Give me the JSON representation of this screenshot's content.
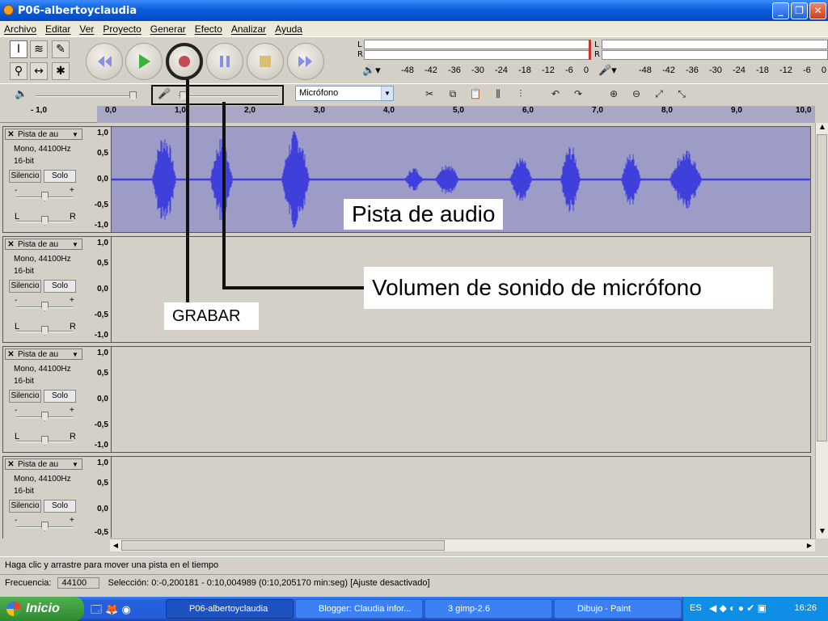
{
  "window": {
    "title": "P06-albertoyclaudia"
  },
  "menu": [
    "Archivo",
    "Editar",
    "Ver",
    "Proyecto",
    "Generar",
    "Efecto",
    "Analizar",
    "Ayuda"
  ],
  "meters": {
    "play_channels": [
      "L",
      "R"
    ],
    "rec_channels": [
      "L",
      "R"
    ],
    "scale": [
      "-48",
      "-42",
      "-36",
      "-30",
      "-24",
      "-18",
      "-12",
      "-6",
      "0"
    ]
  },
  "input_source": "Micrófono",
  "ruler": [
    "- 1,0",
    "0,0",
    "1,0",
    "2,0",
    "3,0",
    "4,0",
    "5,0",
    "6,0",
    "7,0",
    "8,0",
    "9,0",
    "10,0"
  ],
  "tracks": [
    {
      "name": "Pista de au",
      "format": "Mono, 44100Hz",
      "bits": "16-bit",
      "mute": "Silencio",
      "solo": "Solo",
      "gain_minus": "-",
      "gain_plus": "+",
      "pan_left": "L",
      "pan_right": "R",
      "scale": [
        "1,0",
        "0,5",
        "0,0",
        "-0,5",
        "-1,0"
      ],
      "has_audio": true
    },
    {
      "name": "Pista de au",
      "format": "Mono, 44100Hz",
      "bits": "16-bit",
      "mute": "Silencio",
      "solo": "Solo",
      "gain_minus": "-",
      "gain_plus": "+",
      "pan_left": "L",
      "pan_right": "R",
      "scale": [
        "1,0",
        "0,5",
        "0,0",
        "-0,5",
        "-1,0"
      ],
      "has_audio": false
    },
    {
      "name": "Pista de au",
      "format": "Mono, 44100Hz",
      "bits": "16-bit",
      "mute": "Silencio",
      "solo": "Solo",
      "gain_minus": "-",
      "gain_plus": "+",
      "pan_left": "L",
      "pan_right": "R",
      "scale": [
        "1,0",
        "0,5",
        "0,0",
        "-0,5",
        "-1,0"
      ],
      "has_audio": false
    },
    {
      "name": "Pista de au",
      "format": "Mono, 44100Hz",
      "bits": "16-bit",
      "mute": "Silencio",
      "solo": "Solo",
      "gain_minus": "-",
      "gain_plus": "+",
      "pan_left": "",
      "pan_right": "",
      "scale": [
        "1,0",
        "0,5",
        "0,0",
        "-0,5"
      ],
      "has_audio": false
    }
  ],
  "annotations": {
    "pista": "Pista de audio",
    "volumen": "Volumen de sonido de micrófono",
    "grabar": "GRABAR"
  },
  "status": {
    "hint": "Haga clic y arrastre para mover una pista en el tiempo",
    "freq_label": "Frecuencia:",
    "freq_value": "44100",
    "selection": "Selección: 0:-0,200181 - 0:10,004989 (0:10,205170 min:seg)   [Ajuste desactivado]"
  },
  "taskbar": {
    "start": "Inicio",
    "tasks": [
      "P06-albertoyclaudia",
      "Blogger: Claudia infor...",
      "3 gimp-2.6",
      "Dibujo - Paint"
    ],
    "lang": "ES",
    "clock": "16:26"
  },
  "colors": {
    "wave": "#3f3fdc",
    "wave_bg": "#9c9cc6",
    "annotation_line": "#111111"
  }
}
